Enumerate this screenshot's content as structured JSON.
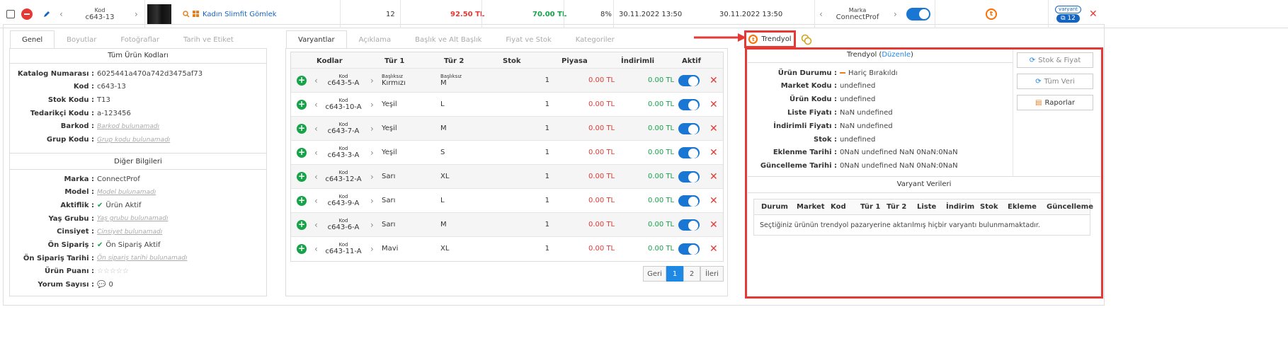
{
  "colors": {
    "accent": "#1e88e5",
    "danger": "#e53935",
    "success": "#16a34a",
    "highlight": "#e53935"
  },
  "top": {
    "kod_label": "Kod",
    "kod_value": "c643-13",
    "product_name": "Kadın Slimfit Gömlek",
    "qty": "12",
    "price_red": "92.50 TL",
    "price_green": "70.00 TL",
    "pct": "8%",
    "date1": "30.11.2022 13:50",
    "date2": "30.11.2022 13:50",
    "marka_label": "Marka",
    "marka_value": "ConnectProf",
    "variant_label": "varyant",
    "variant_count": "12"
  },
  "left": {
    "tabs": [
      "Genel",
      "Boyutlar",
      "Fotoğraflar",
      "Tarih ve Etiket"
    ],
    "section1": "Tüm Ürün Kodları",
    "fields1": [
      {
        "label": "Katalog Numarası :",
        "value": "6025441a470a742d3475af73",
        "muted": false
      },
      {
        "label": "Kod :",
        "value": "c643-13",
        "muted": false
      },
      {
        "label": "Stok Kodu :",
        "value": "T13",
        "muted": false
      },
      {
        "label": "Tedarikçi Kodu :",
        "value": "a-123456",
        "muted": false
      },
      {
        "label": "Barkod :",
        "value": "Barkod bulunamadı",
        "muted": true
      },
      {
        "label": "Grup Kodu :",
        "value": "Grup kodu bulunamadı",
        "muted": true
      }
    ],
    "section2": "Diğer Bilgileri",
    "fields2": [
      {
        "label": "Marka :",
        "value": "ConnectProf",
        "muted": false
      },
      {
        "label": "Model :",
        "value": "Model bulunamadı",
        "muted": true
      },
      {
        "label": "Aktiflik :",
        "value": "Ürün Aktif",
        "muted": false,
        "check": true
      },
      {
        "label": "Yaş Grubu :",
        "value": "Yaş grubu bulunamadı",
        "muted": true
      },
      {
        "label": "Cinsiyet :",
        "value": "Cinsiyet bulunamadı",
        "muted": true
      },
      {
        "label": "Ön Sipariş :",
        "value": "Ön Sipariş Aktif",
        "muted": false,
        "check": true
      },
      {
        "label": "Ön Sipariş Tarihi :",
        "value": "Ön sipariş tarihi bulunamadı",
        "muted": true
      },
      {
        "label": "Ürün Puanı :",
        "value": "☆☆☆☆☆",
        "muted": false,
        "stars": true
      },
      {
        "label": "Yorum Sayısı :",
        "value": "0",
        "muted": false,
        "comment": true
      }
    ]
  },
  "mid": {
    "tabs": [
      "Varyantlar",
      "Açıklama",
      "Başlık ve Alt Başlık",
      "Fiyat ve Stok",
      "Kategoriler"
    ],
    "headers": [
      "Kodlar",
      "Tür 1",
      "Tür 2",
      "Stok",
      "Piyasa",
      "İndirimli",
      "Aktif"
    ],
    "kod_label": "Kod",
    "rows": [
      {
        "kod": "c643-5-A",
        "t1_small": "Başlıksız",
        "t1": "Kırmızı",
        "t2_small": "Başlıksız",
        "t2": "M",
        "stok": "1",
        "piyasa": "0.00 TL",
        "indirimli": "0.00 TL"
      },
      {
        "kod": "c643-10-A",
        "t1_small": "",
        "t1": "Yeşil",
        "t2_small": "",
        "t2": "L",
        "stok": "1",
        "piyasa": "0.00 TL",
        "indirimli": "0.00 TL"
      },
      {
        "kod": "c643-7-A",
        "t1_small": "",
        "t1": "Yeşil",
        "t2_small": "",
        "t2": "M",
        "stok": "1",
        "piyasa": "0.00 TL",
        "indirimli": "0.00 TL"
      },
      {
        "kod": "c643-3-A",
        "t1_small": "",
        "t1": "Yeşil",
        "t2_small": "",
        "t2": "S",
        "stok": "1",
        "piyasa": "0.00 TL",
        "indirimli": "0.00 TL"
      },
      {
        "kod": "c643-12-A",
        "t1_small": "",
        "t1": "Sarı",
        "t2_small": "",
        "t2": "XL",
        "stok": "1",
        "piyasa": "0.00 TL",
        "indirimli": "0.00 TL"
      },
      {
        "kod": "c643-9-A",
        "t1_small": "",
        "t1": "Sarı",
        "t2_small": "",
        "t2": "L",
        "stok": "1",
        "piyasa": "0.00 TL",
        "indirimli": "0.00 TL"
      },
      {
        "kod": "c643-6-A",
        "t1_small": "",
        "t1": "Sarı",
        "t2_small": "",
        "t2": "M",
        "stok": "1",
        "piyasa": "0.00 TL",
        "indirimli": "0.00 TL"
      },
      {
        "kod": "c643-11-A",
        "t1_small": "",
        "t1": "Mavi",
        "t2_small": "",
        "t2": "XL",
        "stok": "1",
        "piyasa": "0.00 TL",
        "indirimli": "0.00 TL"
      }
    ],
    "pagination": {
      "prev": "Geri",
      "pages": [
        "1",
        "2"
      ],
      "next": "İleri"
    }
  },
  "right": {
    "tab_label": "Trendyol",
    "title": "Trendyol",
    "edit": "Düzenle",
    "fields": [
      {
        "label": "Ürün Durumu :",
        "value": "Hariç Bırakıldı",
        "dash": true
      },
      {
        "label": "Market Kodu :",
        "value": "undefined"
      },
      {
        "label": "Ürün Kodu :",
        "value": "undefined"
      },
      {
        "label": "Liste Fiyatı :",
        "value": "NaN undefined"
      },
      {
        "label": "İndirimli Fiyatı :",
        "value": "NaN undefined"
      },
      {
        "label": "Stok :",
        "value": "undefined"
      },
      {
        "label": "Eklenme Tarihi :",
        "value": "0NaN undefined NaN 0NaN:0NaN"
      },
      {
        "label": "Güncelleme Tarihi :",
        "value": "0NaN undefined NaN 0NaN:0NaN"
      }
    ],
    "buttons": [
      "Stok & Fiyat",
      "Tüm Veri",
      "Raporlar"
    ],
    "variant_title": "Varyant Verileri",
    "variant_headers": [
      "Durum",
      "Market",
      "Kod",
      "Tür 1",
      "Tür 2",
      "Liste",
      "İndirim",
      "Stok",
      "Ekleme",
      "Güncelleme"
    ],
    "empty": "Seçtiğiniz ürünün trendyol pazaryerine aktarılmış hiçbir varyantı bulunmamaktadır."
  }
}
